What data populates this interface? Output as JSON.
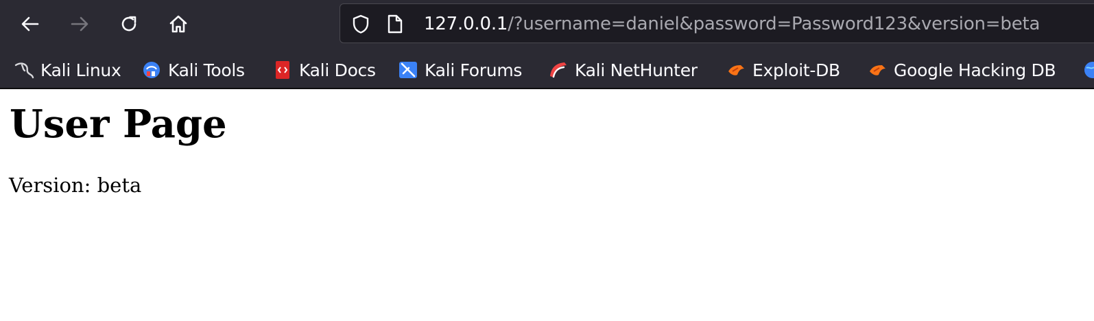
{
  "browser": {
    "url_host": "127.0.0.1",
    "url_rest": "/?username=daniel&password=Password123&version=beta",
    "nav": {
      "back_icon": "back-arrow-icon",
      "forward_icon": "forward-arrow-icon",
      "reload_icon": "reload-icon",
      "home_icon": "home-icon",
      "forward_enabled": false
    },
    "bookmarks": [
      {
        "label": "Kali Linux",
        "icon": "kali-dragon-icon"
      },
      {
        "label": "Kali Tools",
        "icon": "kali-tools-icon"
      },
      {
        "label": "Kali Docs",
        "icon": "kali-docs-icon"
      },
      {
        "label": "Kali Forums",
        "icon": "kali-forums-icon"
      },
      {
        "label": "Kali NetHunter",
        "icon": "kali-nethunter-icon"
      },
      {
        "label": "Exploit-DB",
        "icon": "exploit-db-icon"
      },
      {
        "label": "Google Hacking DB",
        "icon": "google-hacking-db-icon"
      }
    ],
    "colors": {
      "chrome_bg": "#2b2a33",
      "url_bar_bg": "#1c1b22",
      "text": "#fbfbfe",
      "text_muted": "#a9a9b0"
    }
  },
  "page": {
    "title": "User Page",
    "version_text": "Version: beta"
  }
}
